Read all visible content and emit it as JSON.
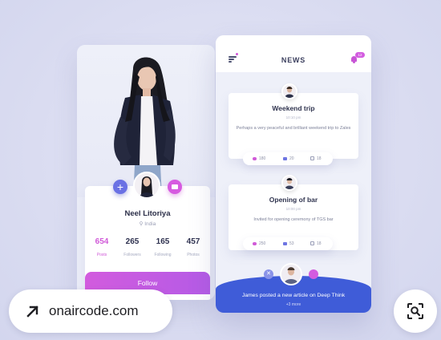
{
  "colors": {
    "accent_pink": "#d05ad8",
    "accent_blue": "#3f5cd8",
    "background": "#dcdff2"
  },
  "profile": {
    "name": "Neel Litoriya",
    "location": "India",
    "stats": [
      {
        "value": "654",
        "label": "Posts"
      },
      {
        "value": "265",
        "label": "Followers"
      },
      {
        "value": "165",
        "label": "Following"
      },
      {
        "value": "457",
        "label": "Photos"
      }
    ],
    "follow_label": "Follow",
    "icons": {
      "add": "plus-icon",
      "message": "message-icon",
      "location": "location-pin-icon"
    }
  },
  "news": {
    "title": "NEWS",
    "notification_count": "12",
    "posts": [
      {
        "title": "Weekend trip",
        "time": "10:10 pm",
        "text": "Perhaps a very peaceful and brilliant weekend trip to Zales",
        "likes": "180",
        "comments": "20",
        "shares": "18"
      },
      {
        "title": "Opening of bar",
        "time": "10:00 pm",
        "text": "Invited for opening ceremony of TGS bar",
        "likes": "250",
        "comments": "53",
        "shares": "18"
      }
    ],
    "banner": {
      "text": "James posted a new article on Deep Think",
      "more": "+3 more"
    }
  },
  "overlay": {
    "source": "onaircode.com",
    "source_icon": "arrow-up-right-icon",
    "lens_icon": "visual-search-icon"
  }
}
